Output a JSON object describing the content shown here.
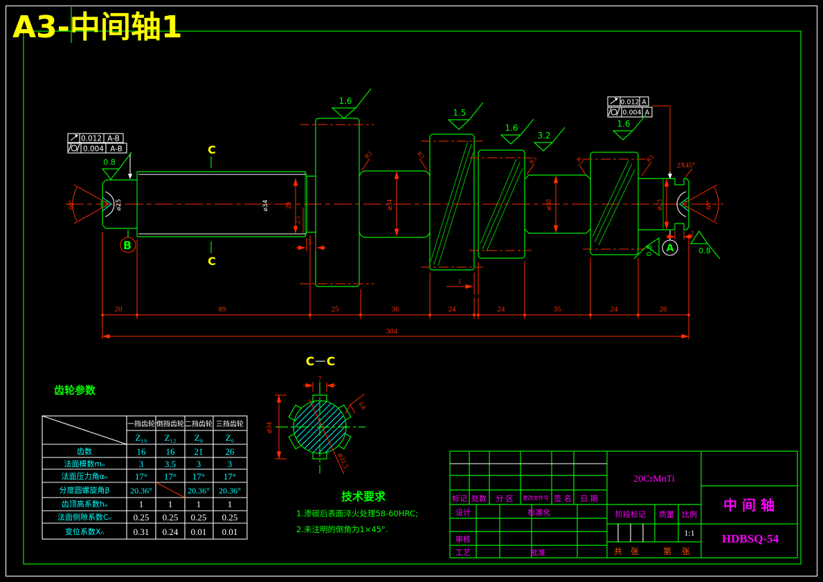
{
  "page": {
    "title": "A3-中间轴1"
  },
  "gtol": {
    "l1v": "0.012",
    "l1d": "A-B",
    "l2v": "0.004",
    "l2d": "A-B",
    "r1v": "0.012",
    "r1d": "A",
    "r2v": "0.004",
    "r2d": "A"
  },
  "datum": {
    "a": "A",
    "b": "B"
  },
  "finish": {
    "f1": "1.6",
    "f2": "1.5",
    "f3": "1.6",
    "f4": "3.2",
    "f5": "1.6",
    "left": "0.8",
    "right1": "0.8",
    "right2": "0.8",
    "section": "0.8"
  },
  "dims": {
    "chain": [
      "20",
      "89",
      "25",
      "36",
      "24",
      "24",
      "35",
      "24",
      "26"
    ],
    "total": "304",
    "gap": "1",
    "neck_dia": "29",
    "neck_half": "2.5",
    "neck_w": "3",
    "dia_left": "⌀25",
    "dia_spline": "⌀34",
    "dia_mid": "⌀34",
    "dia_groove": "⌀30",
    "dia_right": "⌀23",
    "angle": "60°",
    "chamfer": "2X45°",
    "fillet": "R3",
    "end_groove": "2"
  },
  "cut": {
    "label": "C"
  },
  "section": {
    "width": "7",
    "od": "⌀34",
    "root": "⌀31.5"
  },
  "gear_table": {
    "title": "齿轮参数",
    "headers": [
      "一挡齿轮",
      "倒挡齿轮",
      "二挡齿轮",
      "三挡齿轮"
    ],
    "z": [
      "Z₁₀",
      "Z₁₂",
      "Z₈",
      "Z₆"
    ],
    "rows": [
      {
        "label": "齿数",
        "v": [
          "16",
          "16",
          "21",
          "26"
        ]
      },
      {
        "label": "法面模数mₙ",
        "v": [
          "3",
          "3.5",
          "3",
          "3"
        ]
      },
      {
        "label": "法面压力角αₙ",
        "v": [
          "17°",
          "17°",
          "17°",
          "17°"
        ]
      },
      {
        "label": "分度圆螺旋角β",
        "v": [
          "20.36°",
          "",
          "20.36°",
          "20.36°"
        ]
      },
      {
        "label": "齿顶高系数hₐ",
        "v": [
          "1",
          "1",
          "1",
          "1"
        ]
      },
      {
        "label": "法面侧隙系数Cₙ",
        "v": [
          "0.25",
          "0.25",
          "0.25",
          "0.25"
        ]
      },
      {
        "label": "变位系数Xₙ",
        "v": [
          "0.31",
          "0.24",
          "0.01",
          "0.01"
        ]
      }
    ]
  },
  "tech": {
    "title": "技术要求",
    "l1": "1.渗碳后表面淬火处理58-60HRC;",
    "l2": "2.未注明的倒角为1×45°."
  },
  "tb": {
    "material": "20CrMnTi",
    "part": "中 间 轴",
    "no": "HDBSQ-54",
    "biaoji": "标记",
    "chushu": "处数",
    "fenqu": "分 区",
    "genggai": "更改文件号",
    "qianming": "签 名",
    "riqi": "日 期",
    "sheji": "设计",
    "biaozhunhua": "标准化",
    "shenhe": "审核",
    "gongyi": "工艺",
    "pizhun": "批准",
    "jieduan": "阶段标记",
    "zhiliang": "质量",
    "bili": "比例",
    "scale": "1:1",
    "gong": "共",
    "zhang1": "张",
    "di": "第",
    "zhang2": "张"
  }
}
